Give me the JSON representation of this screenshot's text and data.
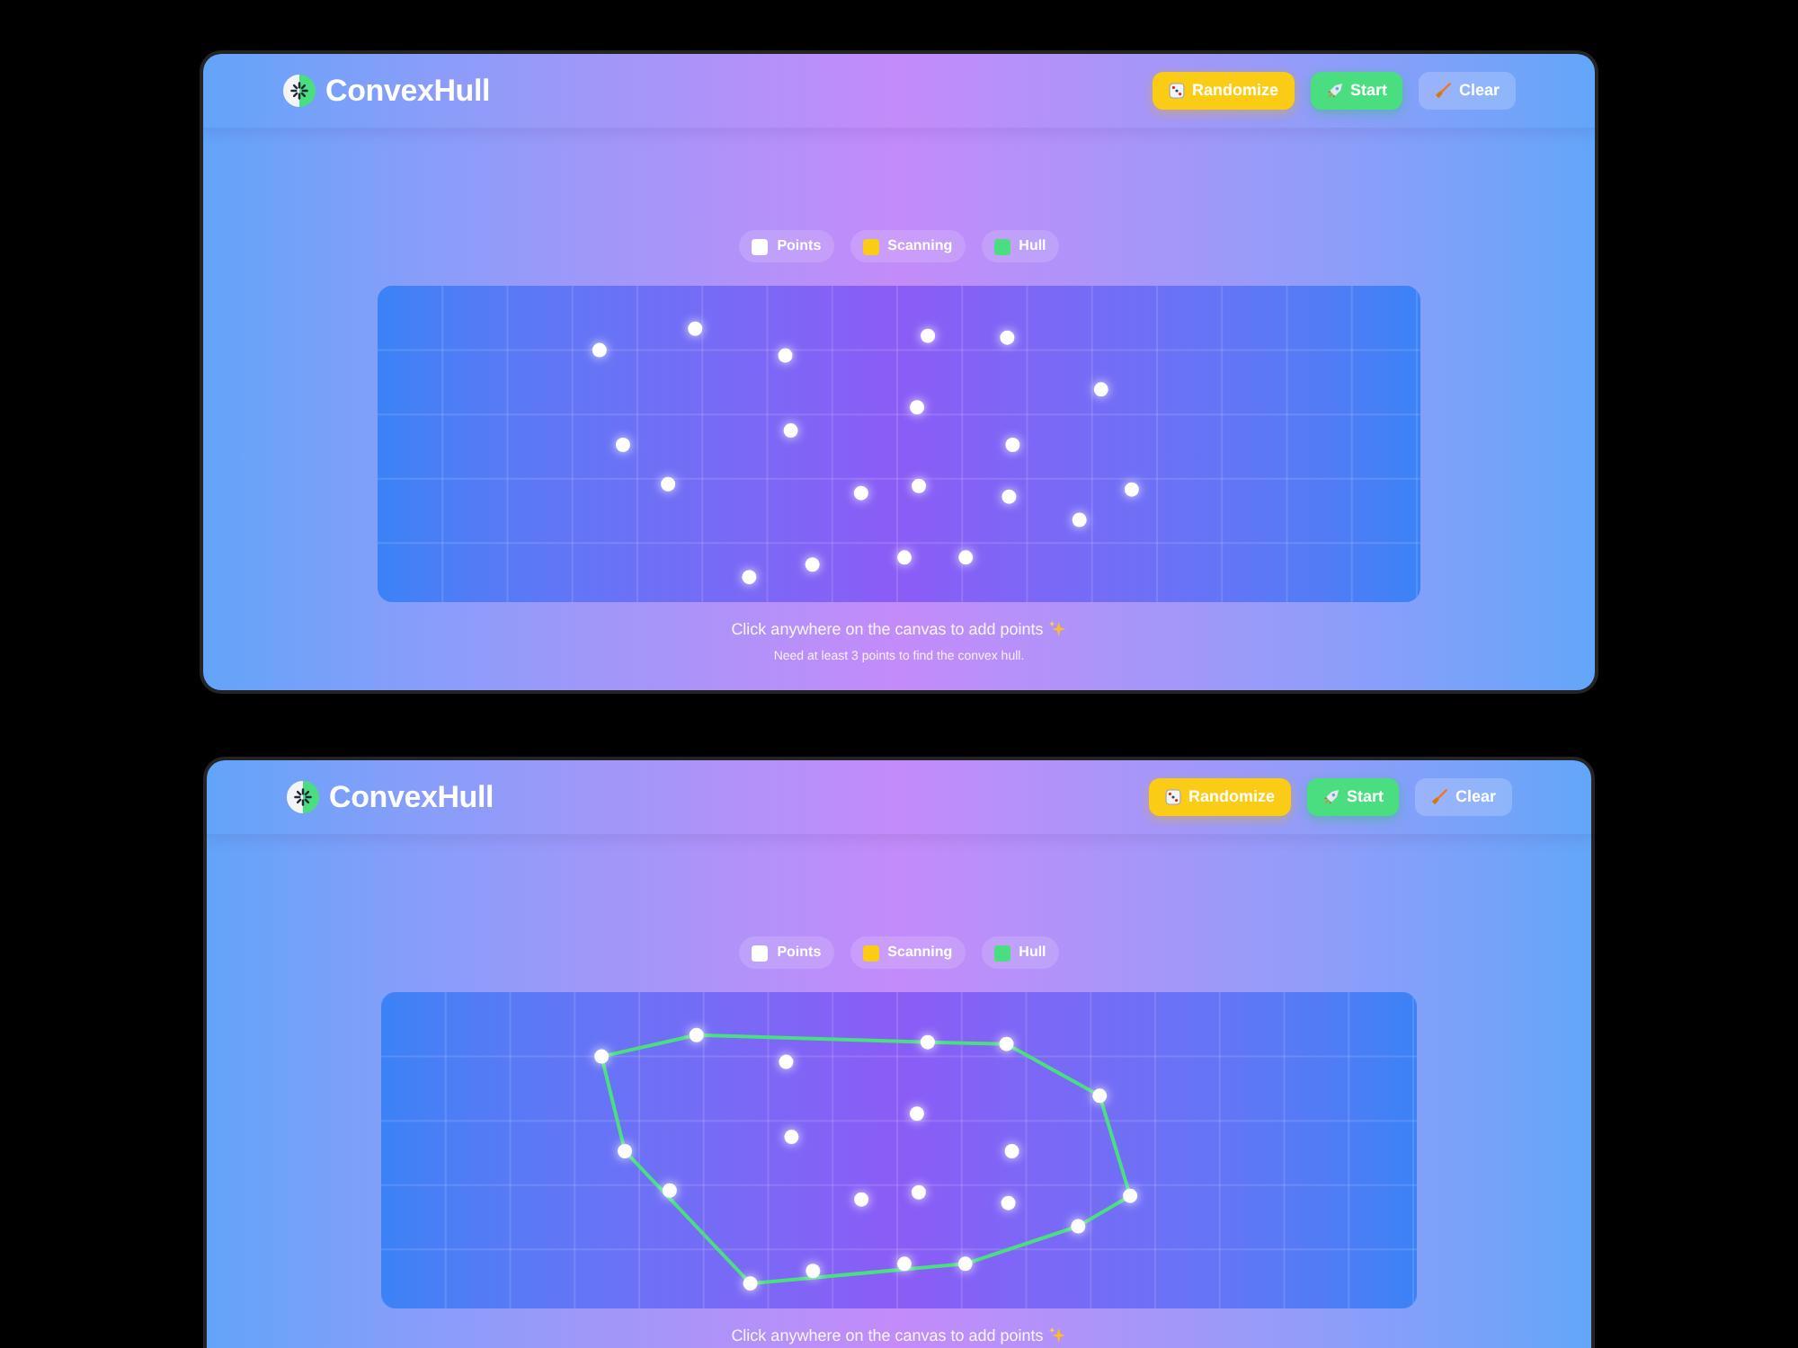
{
  "panels": [
    {
      "header": {
        "title": "ConvexHull",
        "buttons": [
          {
            "kind": "randomize",
            "label": "Randomize"
          },
          {
            "kind": "start",
            "label": "Start"
          },
          {
            "kind": "clear",
            "label": "Clear"
          }
        ]
      },
      "legend": [
        {
          "label": "Points",
          "color": "#ffffff"
        },
        {
          "label": "Scanning",
          "color": "#facc15"
        },
        {
          "label": "Hull",
          "color": "#4ade80"
        }
      ],
      "canvas": {
        "hull_visible": false
      },
      "instruction": "Click anywhere on the canvas to add points",
      "hint": "Need at least 3 points to find the convex hull."
    },
    {
      "header": {
        "title": "ConvexHull",
        "buttons": [
          {
            "kind": "randomize",
            "label": "Randomize"
          },
          {
            "kind": "start",
            "label": "Start"
          },
          {
            "kind": "clear",
            "label": "Clear"
          }
        ]
      },
      "legend": [
        {
          "label": "Points",
          "color": "#ffffff"
        },
        {
          "label": "Scanning",
          "color": "#facc15"
        },
        {
          "label": "Hull",
          "color": "#4ade80"
        }
      ],
      "canvas": {
        "hull_visible": true
      },
      "instruction": "Click anywhere on the canvas to add points"
    }
  ]
}
